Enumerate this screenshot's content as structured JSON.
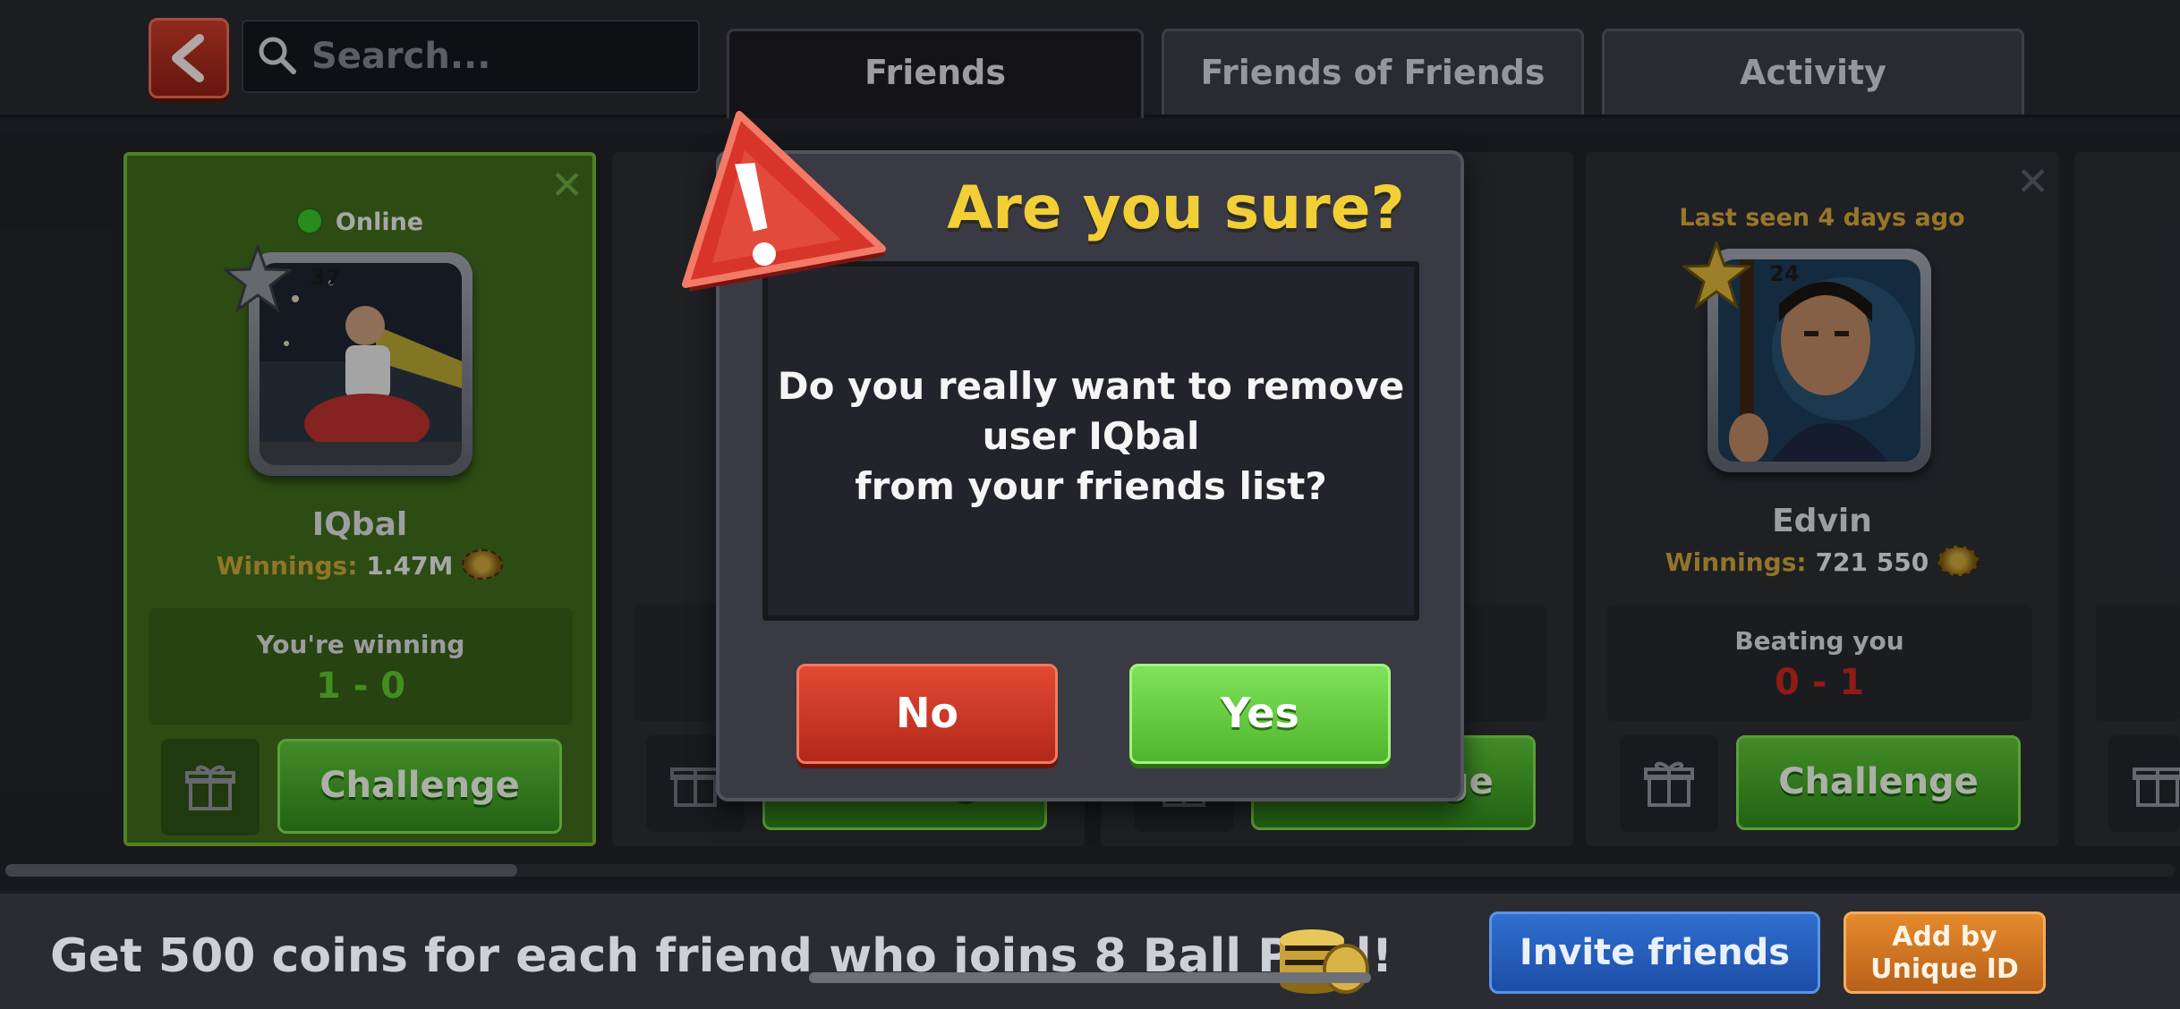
{
  "header": {
    "search_placeholder": "Search...",
    "tabs": [
      {
        "label": "Friends",
        "active": true
      },
      {
        "label": "Friends of Friends",
        "active": false
      },
      {
        "label": "Activity",
        "active": false
      }
    ]
  },
  "friends": [
    {
      "status": "Online",
      "level": "37",
      "name": "IQbal",
      "winnings_label": "Winnings:",
      "winnings": "1.47M",
      "record_label": "You're winning",
      "record": "1 - 0",
      "challenge_label": "Challenge"
    },
    {
      "status": "",
      "level": "",
      "name": "",
      "winnings_label": "",
      "winnings": "",
      "record_label": "",
      "record": "",
      "challenge_label": "Challenge"
    },
    {
      "status": "",
      "level": "",
      "name": "",
      "winnings_label": "",
      "winnings": "",
      "record_label": "",
      "record": "",
      "challenge_label": "Challenge"
    },
    {
      "status": "Last seen 4 days ago",
      "level": "24",
      "name": "Edvin",
      "winnings_label": "Winnings:",
      "winnings": "721 550",
      "record_label": "Beating you",
      "record": "0 - 1",
      "challenge_label": "Challenge"
    }
  ],
  "dialog": {
    "title": "Are you sure?",
    "message_line1": "Do you really want to remove",
    "message_line2": "user IQbal",
    "message_line3": "from your friends list?",
    "no_label": "No",
    "yes_label": "Yes"
  },
  "footer": {
    "promo_text": "Get 500 coins for each friend who joins 8 Ball Pool!",
    "invite_label": "Invite friends",
    "uid_label_line1": "Add by",
    "uid_label_line2": "Unique ID"
  },
  "colors": {
    "online": "#3cbf2a",
    "winning": "#5ec42e",
    "losing": "#c7281c",
    "title_yellow": "#f2cf36",
    "accent_green": "#5dc238"
  },
  "icons": [
    "back-arrow-icon",
    "search-icon",
    "close-icon",
    "online-dot-icon",
    "level-star-icon",
    "coin-chip-icon",
    "gift-icon",
    "warning-icon",
    "coin-stack-icon"
  ]
}
